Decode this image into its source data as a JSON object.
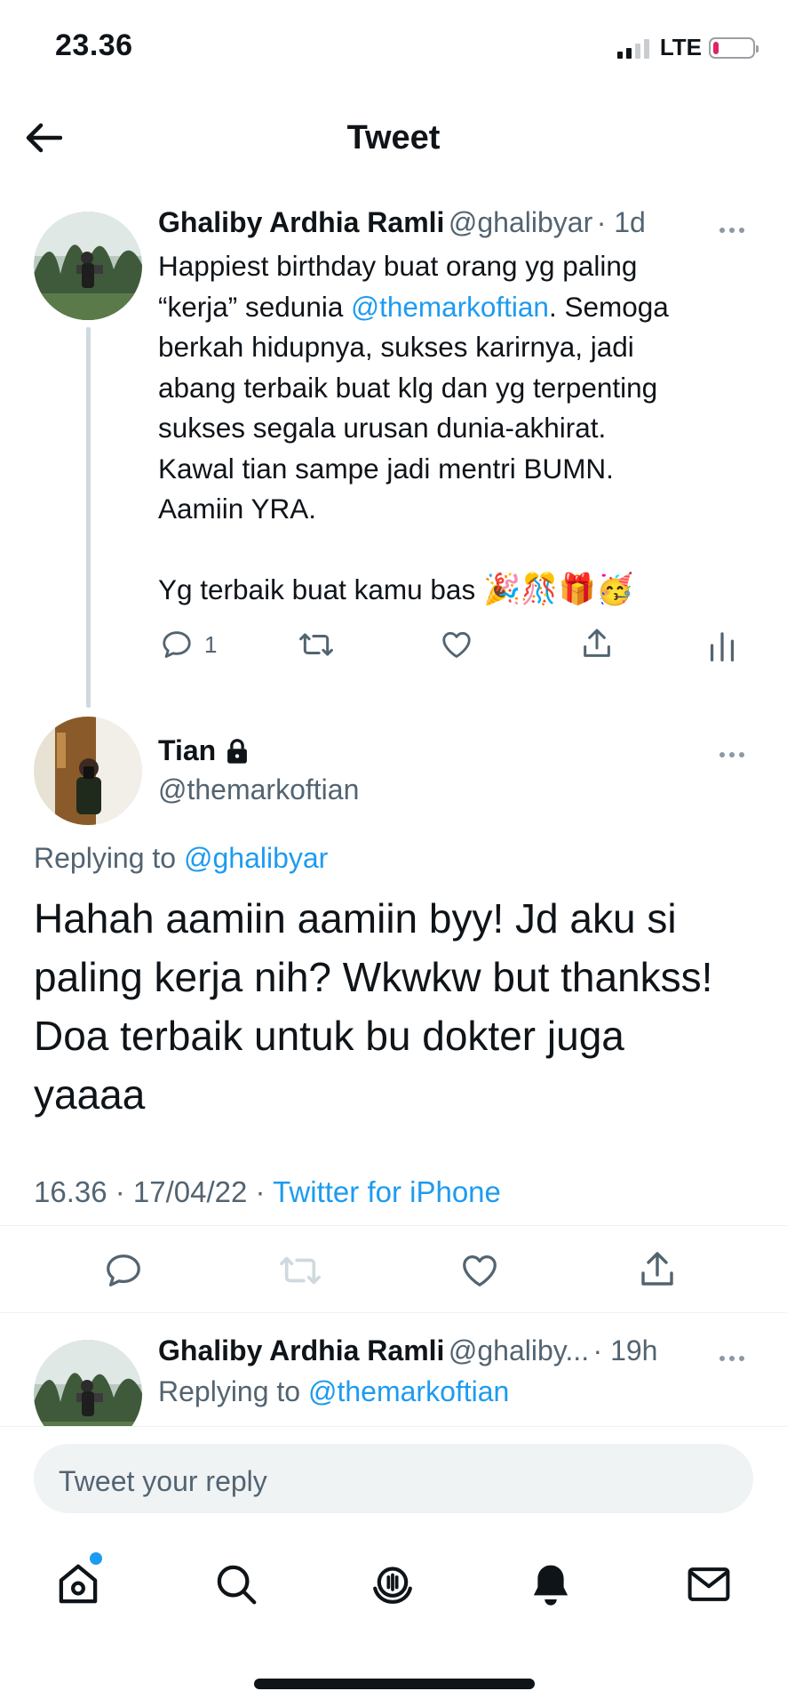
{
  "status_bar": {
    "time": "23.36",
    "network": "LTE",
    "battery_fraction": 0.15
  },
  "header": {
    "title": "Tweet"
  },
  "thread": {
    "parent": {
      "name": "Ghaliby Ardhia Ramli",
      "handle": "@ghalibyar",
      "age": "· 1d",
      "text_1": "Happiest birthday buat orang yg paling\n“kerja” sedunia ",
      "mention": "@themarkoftian",
      "text_2": ". Semoga\nberkah hidupnya, sukses karirnya, jadi\nabang terbaik buat klg dan yg terpenting\nsukses segala urusan dunia-akhirat.\nKawal tian sampe jadi mentri BUMN.\nAamiin YRA.\n\nYg terbaik buat kamu bas ",
      "emojis": "🎉🎊🎁🥳",
      "reply_count": "1"
    },
    "focused": {
      "name": "Tian",
      "handle": "@themarkoftian",
      "replying_label": "Replying to ",
      "replying_to": "@ghalibyar",
      "text": "Hahah aamiin aamiin byy! Jd aku si paling kerja nih? Wkwkw but thankss! Doa terbaik untuk bu dokter juga yaaaa",
      "time": "16.36 · 17/04/22 · ",
      "source": "Twitter for iPhone"
    },
    "reply": {
      "name": "Ghaliby Ardhia Ramli",
      "handle": "@ghaliby...",
      "age": "· 19h",
      "replying_label": "Replying to ",
      "replying_to": "@themarkoftian"
    }
  },
  "compose": {
    "placeholder": "Tweet your reply"
  },
  "bottom_nav": {
    "items": [
      "home-icon",
      "search-icon",
      "spaces-icon",
      "notifications-icon",
      "messages-icon"
    ],
    "active": "home-icon"
  },
  "colors": {
    "accent": "#1d9bf0",
    "text": "#0f1419",
    "muted": "#536471"
  },
  "icons": {
    "back": "arrow-left-icon",
    "more": "more-dots-icon",
    "lock": "lock-icon",
    "reply": "reply-icon",
    "retweet": "retweet-icon",
    "like": "heart-icon",
    "share": "share-icon",
    "analytics": "analytics-icon"
  }
}
